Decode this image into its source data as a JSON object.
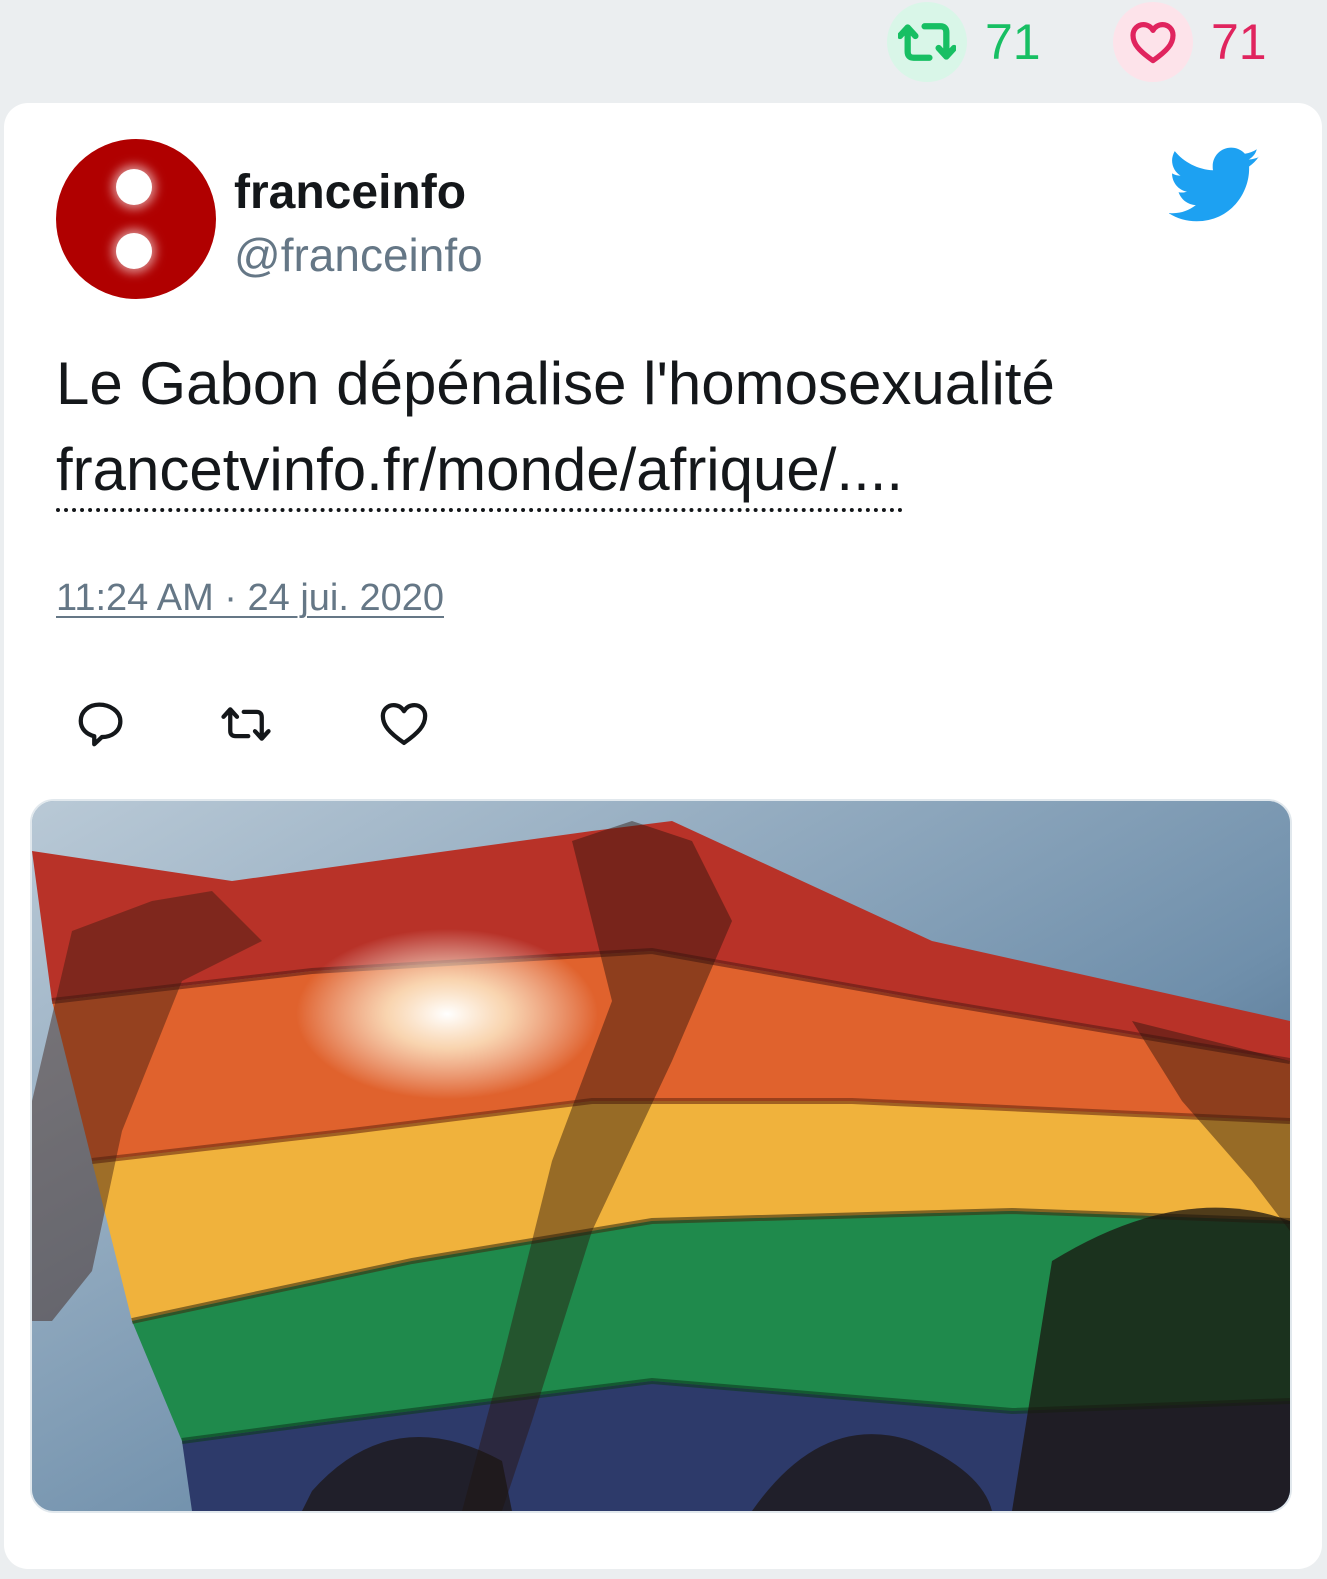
{
  "stats": {
    "retweets": "71",
    "likes": "71",
    "retweet_color": "#17bf63",
    "like_color": "#e0245e"
  },
  "author": {
    "name": "franceinfo",
    "handle": "@franceinfo",
    "avatar_color": "#b00000"
  },
  "tweet": {
    "text": "Le Gabon dépénalise l'homosexualité",
    "link": "francetvinfo.fr/monde/afrique/...."
  },
  "timestamp": "11:24 AM · 24 jui. 2020",
  "icons": {
    "brand": "twitter-bird-icon",
    "actions": [
      "reply-icon",
      "retweet-icon",
      "like-icon"
    ]
  },
  "media": {
    "subject": "rainbow-flag-photo",
    "colors": [
      "#c8322a",
      "#e8692c",
      "#f2b33a",
      "#1f8a4c",
      "#2c3d6e"
    ]
  }
}
